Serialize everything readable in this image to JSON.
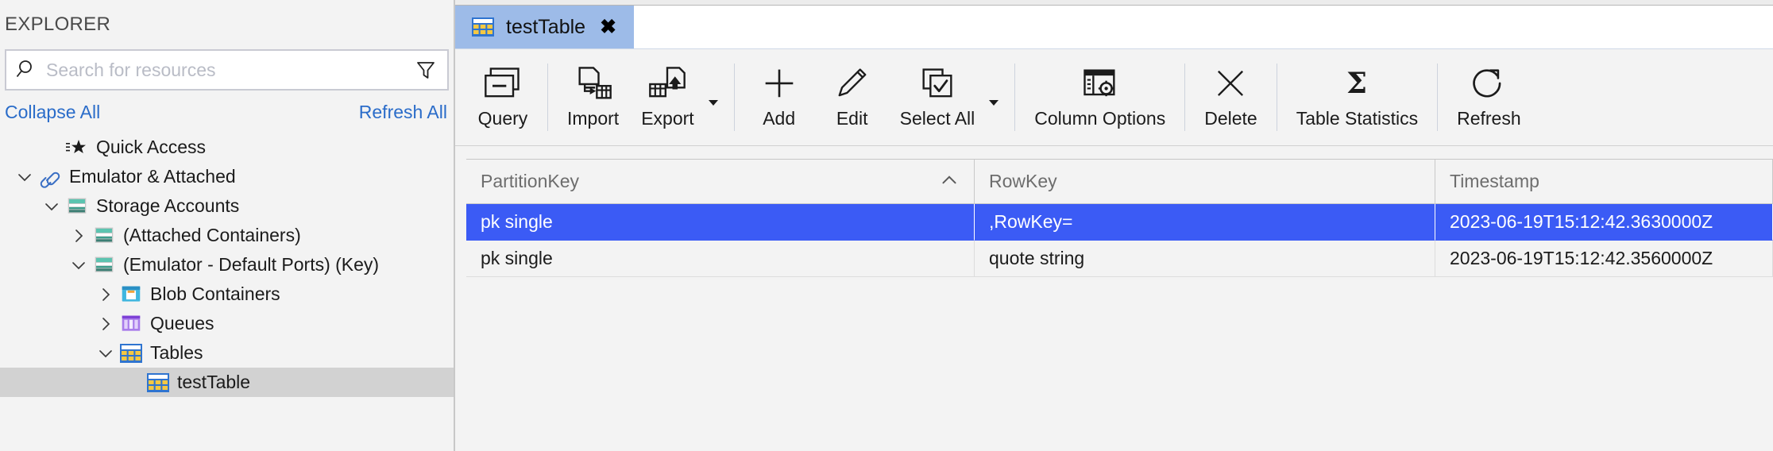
{
  "sidebar": {
    "title": "EXPLORER",
    "search": {
      "placeholder": "Search for resources",
      "value": ""
    },
    "collapse_all": "Collapse All",
    "refresh_all": "Refresh All",
    "tree": [
      {
        "label": "Quick Access",
        "icon": "quick-access-star-icon",
        "depth": 1,
        "twisty": "none",
        "selected": false
      },
      {
        "label": "Emulator & Attached",
        "icon": "link-chain-icon",
        "depth": 0,
        "twisty": "down",
        "selected": false
      },
      {
        "label": "Storage Accounts",
        "icon": "storage-account-icon",
        "depth": 1,
        "twisty": "down",
        "selected": false
      },
      {
        "label": "(Attached Containers)",
        "icon": "storage-account-icon",
        "depth": 2,
        "twisty": "right",
        "selected": false
      },
      {
        "label": "(Emulator - Default Ports) (Key)",
        "icon": "storage-account-icon",
        "depth": 2,
        "twisty": "down",
        "selected": false
      },
      {
        "label": "Blob Containers",
        "icon": "blob-container-icon",
        "depth": 3,
        "twisty": "right",
        "selected": false
      },
      {
        "label": "Queues",
        "icon": "queue-icon",
        "depth": 3,
        "twisty": "right",
        "selected": false
      },
      {
        "label": "Tables",
        "icon": "table-icon",
        "depth": 3,
        "twisty": "down",
        "selected": false
      },
      {
        "label": "testTable",
        "icon": "table-icon",
        "depth": 4,
        "twisty": "none",
        "selected": true
      }
    ]
  },
  "tabs": [
    {
      "label": "testTable",
      "icon": "table-icon",
      "close": "✖",
      "active": true
    }
  ],
  "toolbar": {
    "groups": [
      {
        "items": [
          {
            "label": "Query",
            "icon": "query-window-icon",
            "caret": false
          }
        ]
      },
      {
        "items": [
          {
            "label": "Import",
            "icon": "import-icon",
            "caret": false
          },
          {
            "label": "Export",
            "icon": "export-icon",
            "caret": true
          }
        ]
      },
      {
        "items": [
          {
            "label": "Add",
            "icon": "plus-icon",
            "caret": false
          },
          {
            "label": "Edit",
            "icon": "pencil-icon",
            "caret": false
          },
          {
            "label": "Select All",
            "icon": "select-all-icon",
            "caret": true
          }
        ]
      },
      {
        "items": [
          {
            "label": "Column Options",
            "icon": "column-options-icon",
            "caret": false
          }
        ]
      },
      {
        "items": [
          {
            "label": "Delete",
            "icon": "x-cross-icon",
            "caret": false
          }
        ]
      },
      {
        "items": [
          {
            "label": "Table Statistics",
            "icon": "sigma-icon",
            "caret": false
          }
        ]
      },
      {
        "items": [
          {
            "label": "Refresh",
            "icon": "refresh-circular-arrow-icon",
            "caret": false
          }
        ]
      }
    ]
  },
  "grid": {
    "columns": [
      {
        "label": "PartitionKey",
        "sort": "asc"
      },
      {
        "label": "RowKey",
        "sort": "none"
      },
      {
        "label": "Timestamp",
        "sort": "none"
      }
    ],
    "rows": [
      {
        "selected": true,
        "cells": [
          "pk single",
          ",RowKey=",
          "2023-06-19T15:12:42.3630000Z"
        ]
      },
      {
        "selected": false,
        "cells": [
          "pk single",
          "quote string",
          "2023-06-19T15:12:42.3560000Z"
        ]
      }
    ]
  },
  "colors": {
    "selection_blue": "#3b5bf5",
    "tab_blue": "#9dbbe8",
    "link_blue": "#2a6cc9",
    "teal_storage": "#4ec3ae",
    "panel_gray": "#f3f3f3"
  }
}
